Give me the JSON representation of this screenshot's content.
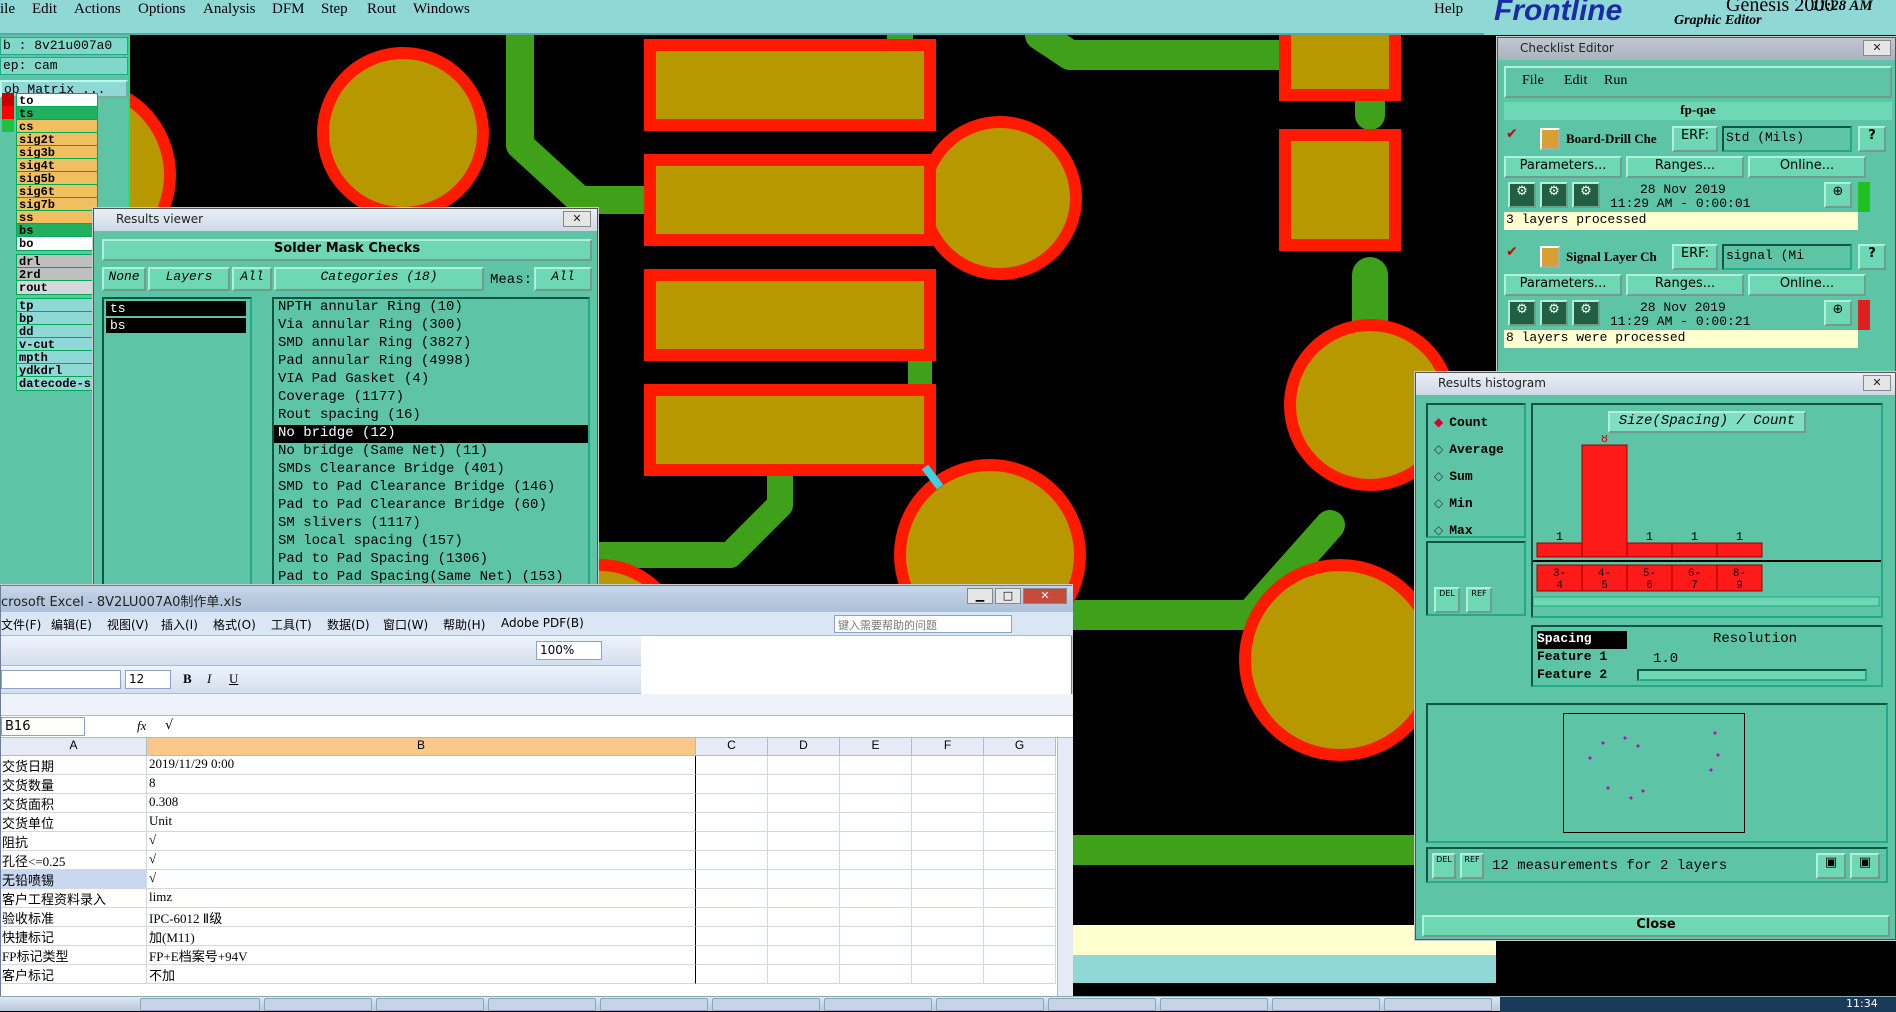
{
  "menubar": {
    "items": [
      "ile",
      "Edit",
      "Actions",
      "Options",
      "Analysis",
      "DFM",
      "Step",
      "Rout",
      "Windows"
    ],
    "help": "Help"
  },
  "brand": {
    "logo": "Frontline",
    "product": "Genesis 2000",
    "subtitle": "Graphic Editor",
    "time": "11:28 AM"
  },
  "left_panel": {
    "job_label": "b : 8v21u007a0",
    "step_label": "ep: cam",
    "matrix_button": "ob Matrix ...",
    "layers": [
      {
        "name": "to",
        "color": "#ffffff",
        "box": "#cc0000"
      },
      {
        "name": "ts",
        "color": "#20b060",
        "box": "#ff0000"
      },
      {
        "name": "cs",
        "color": "#f0c060",
        "box": "#20c040"
      },
      {
        "name": "sig2t",
        "color": "#f0c060",
        "box": "#5ec4a6"
      },
      {
        "name": "sig3b",
        "color": "#f0c060",
        "box": "#5ec4a6"
      },
      {
        "name": "sig4t",
        "color": "#f0c060",
        "box": "#5ec4a6"
      },
      {
        "name": "sig5b",
        "color": "#f0c060",
        "box": "#5ec4a6"
      },
      {
        "name": "sig6t",
        "color": "#f0c060",
        "box": "#5ec4a6"
      },
      {
        "name": "sig7b",
        "color": "#f0c060",
        "box": "#5ec4a6"
      },
      {
        "name": "ss",
        "color": "#f0c060",
        "box": "#5ec4a6"
      },
      {
        "name": "bs",
        "color": "#20b060",
        "box": "#5ec4a6"
      },
      {
        "name": "bo",
        "color": "#ffffff",
        "box": "#5ec4a6"
      },
      {
        "name": "drl",
        "color": "#bfbfbf",
        "box": "#5ec4a6"
      },
      {
        "name": "2rd",
        "color": "#bfbfbf",
        "box": "#5ec4a6"
      },
      {
        "name": "rout",
        "color": "#d8d8d8",
        "box": "#5ec4a6"
      },
      {
        "name": "tp",
        "color": "#8fd8d6",
        "box": "#5ec4a6"
      },
      {
        "name": "bp",
        "color": "#8fd8d6",
        "box": "#5ec4a6"
      },
      {
        "name": "dd",
        "color": "#8fd8d6",
        "box": "#5ec4a6"
      },
      {
        "name": "v-cut",
        "color": "#8fd8d6",
        "box": "#5ec4a6"
      },
      {
        "name": "mpth",
        "color": "#8fd8d6",
        "box": "#5ec4a6"
      },
      {
        "name": "ydkdrl",
        "color": "#8fd8d6",
        "box": "#5ec4a6"
      },
      {
        "name": "datecode-s",
        "color": "#8fd8d6",
        "box": "#5ec4a6"
      }
    ]
  },
  "results_viewer": {
    "title": "Results viewer",
    "header": "Solder Mask Checks",
    "none_btn": "None",
    "layers_btn": "Layers",
    "all_btn": "All",
    "categories_btn": "Categories (18)",
    "meas_label": "Meas:",
    "meas_value": "All",
    "layers": [
      "ts",
      "bs"
    ],
    "categories": [
      "NPTH annular Ring (10)",
      "Via annular Ring (300)",
      "SMD annular Ring (3827)",
      "Pad annular Ring (4998)",
      "VIA Pad Gasket (4)",
      "Coverage (1177)",
      "Rout spacing (16)",
      "No bridge (12)",
      "No bridge (Same Net) (11)",
      "SMDs Clearance Bridge (401)",
      "SMD to Pad Clearance Bridge (146)",
      "Pad to Pad Clearance Bridge (60)",
      "SM slivers (1117)",
      "SM local spacing (157)",
      "Pad to Pad Spacing (1306)",
      "Pad to Pad Spacing(Same Net) (153)"
    ],
    "selected_index": 7
  },
  "checklist": {
    "title": "Checklist Editor",
    "menu": [
      "File",
      "Edit",
      "Run"
    ],
    "name": "fp-qae",
    "entries": [
      {
        "label": "Board-Drill Che",
        "erf": "ERF:",
        "mode": "Std (Mils)",
        "date": "28 Nov 2019",
        "time": "11:29 AM - 0:00:01",
        "status": "3 layers processed",
        "status_color": "#20c020"
      },
      {
        "label": "Signal Layer Ch",
        "erf": "ERF:",
        "mode": "signal (Mi",
        "date": "28 Nov 2019",
        "time": "11:29 AM - 0:00:21",
        "status": "8 layers were processed",
        "status_color": "#e02020"
      }
    ],
    "params_btn": "Parameters...",
    "ranges_btn": "Ranges...",
    "online_btn": "Online..."
  },
  "histogram": {
    "title": "Results histogram",
    "options": [
      "Count",
      "Average",
      "Sum",
      "Min",
      "Max"
    ],
    "selected_option": "Count",
    "chart_title": "Size(Spacing) / Count",
    "bins": [
      "3-\n4",
      "4-\n5",
      "5-\n6",
      "6-\n7",
      "8-\n9"
    ],
    "bin_top": [
      "3-",
      "4-",
      "5-",
      "6-",
      "8-"
    ],
    "bin_bottom": [
      "4",
      "5",
      "6",
      "7",
      "9"
    ],
    "counts": [
      1,
      8,
      1,
      1,
      1
    ],
    "attrs": [
      "Spacing",
      "Feature 1",
      "Feature 2"
    ],
    "resolution_label": "Resolution",
    "resolution_value": "1.0",
    "del": "DEL",
    "ref": "REF",
    "status": "12 measurements for 2 layers",
    "close": "Close"
  },
  "excel": {
    "title": "crosoft Excel - 8V2LU007A0制作单.xls",
    "menu": [
      "文件(F)",
      "编辑(E)",
      "视图(V)",
      "插入(I)",
      "格式(O)",
      "工具(T)",
      "数据(D)",
      "窗口(W)",
      "帮助(H)",
      "Adobe PDF(B)"
    ],
    "help_placeholder": "键入需要帮助的问题",
    "zoom": "100%",
    "font_size": "12",
    "name_box": "B16",
    "formula": "√",
    "columns": [
      "A",
      "B",
      "C",
      "D",
      "E",
      "F",
      "G"
    ],
    "rows": [
      [
        "交货日期",
        "2019/11/29 0:00"
      ],
      [
        "交货数量",
        "8"
      ],
      [
        "交货面积",
        "0.308"
      ],
      [
        "交货单位",
        "Unit"
      ],
      [
        "阻抗",
        "√"
      ],
      [
        "孔径<=0.25",
        "√"
      ],
      [
        "无铅喷锡",
        "√"
      ],
      [
        "客户工程资料录入",
        "limz"
      ],
      [
        "验收标准",
        "IPC-6012 Ⅱ级"
      ],
      [
        "快捷标记",
        "加(M11)"
      ],
      [
        "FP标记类型",
        "FP+E档案号+94V"
      ],
      [
        "客户标记",
        "不加"
      ]
    ]
  },
  "taskbar": {
    "clock": "11:34"
  }
}
